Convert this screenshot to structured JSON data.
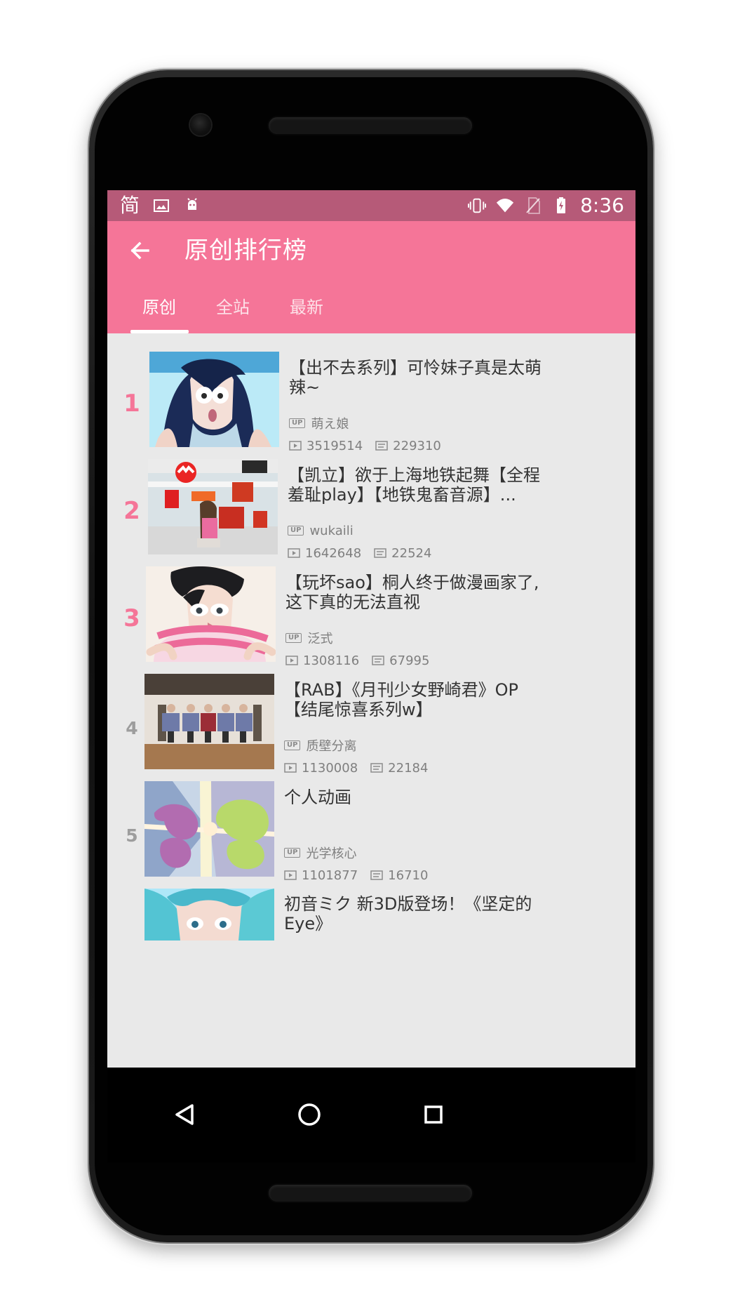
{
  "status_bar": {
    "left_indicator_text": "简",
    "time": "8:36",
    "icons": [
      "image-icon",
      "android-icon",
      "vibrate-icon",
      "wifi-icon",
      "no-sim-icon",
      "battery-icon"
    ]
  },
  "app_bar": {
    "title": "原创排行榜"
  },
  "tabs": [
    {
      "label": "原创",
      "active": true
    },
    {
      "label": "全站",
      "active": false
    },
    {
      "label": "最新",
      "active": false
    }
  ],
  "ranking": [
    {
      "rank": "1",
      "title": "【出不去系列】可怜妹子真是太萌辣~",
      "uploader": "萌え娘",
      "plays": "3519514",
      "comments": "229310"
    },
    {
      "rank": "2",
      "title": "【凯立】欲于上海地铁起舞【全程羞耻play】【地铁鬼畜音源】...",
      "uploader": "wukaili",
      "plays": "1642648",
      "comments": "22524"
    },
    {
      "rank": "3",
      "title": "【玩坏sao】桐人终于做漫画家了,这下真的无法直视",
      "uploader": "泛式",
      "plays": "1308116",
      "comments": "67995"
    },
    {
      "rank": "4",
      "title": "【RAB】《月刊少女野崎君》OP【结尾惊喜系列w】",
      "uploader": "质壁分离",
      "plays": "1130008",
      "comments": "22184"
    },
    {
      "rank": "5",
      "title": "个人动画",
      "uploader": "光学核心",
      "plays": "1101877",
      "comments": "16710"
    },
    {
      "title": "初音ミク 新3D版登场！《坚定的Eye》"
    }
  ],
  "labels": {
    "up_badge": "UP"
  },
  "colors": {
    "status_bar": "#b65a78",
    "app_bar": "#f57598",
    "list_background": "#e9e9e9",
    "rank_accent": "#f57598",
    "rank_muted": "#9d9d9d",
    "title_text": "#333333",
    "meta_text": "#7f7f7f"
  },
  "nav_bar": {
    "buttons": [
      "back-triangle-icon",
      "home-circle-icon",
      "recents-square-icon"
    ]
  }
}
